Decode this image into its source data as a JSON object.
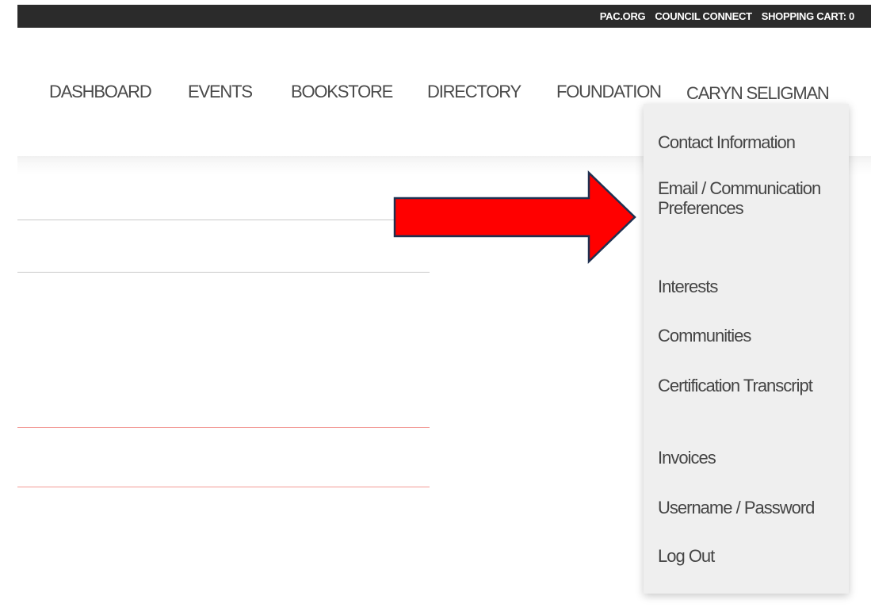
{
  "top_bar": {
    "links": [
      "PAC.ORG",
      "COUNCIL CONNECT",
      "SHOPPING CART: 0"
    ]
  },
  "nav": {
    "dashboard": "DASHBOARD",
    "events": "EVENTS",
    "bookstore": "BOOKSTORE",
    "directory": "DIRECTORY",
    "foundation": "FOUNDATION",
    "user": "CARYN SELIGMAN"
  },
  "user_menu": {
    "items": [
      "Contact Information",
      "Email / Communication Preferences",
      "Interests",
      "Communities",
      "Certification Transcript",
      "Invoices",
      "Username / Password",
      "Log Out"
    ]
  },
  "annotation": {
    "arrow_fill": "#ff0000",
    "arrow_stroke": "#1f3050",
    "icon": "red-arrow-annotation"
  },
  "colors": {
    "top_bar_bg": "#2b2b2b",
    "dropdown_bg": "#efefef",
    "nav_text": "#4a4a4a"
  }
}
